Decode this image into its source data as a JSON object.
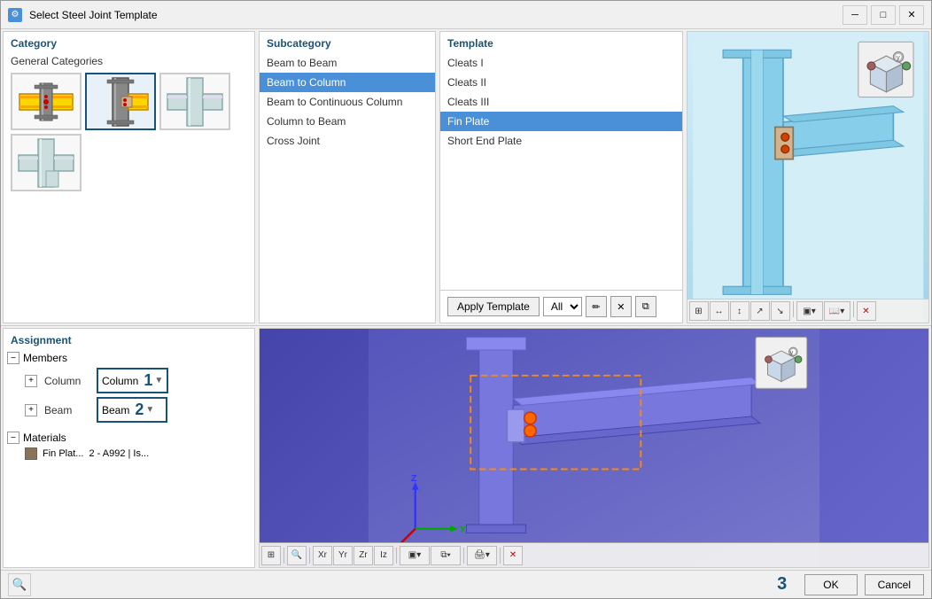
{
  "window": {
    "title": "Select Steel Joint Template",
    "icon": "⚙"
  },
  "category": {
    "header": "Category",
    "general_label": "General Categories",
    "items": [
      {
        "id": "cat-1",
        "label": "Beam-Beam Joint",
        "selected": false
      },
      {
        "id": "cat-2",
        "label": "Beam-Column Joint",
        "selected": true
      },
      {
        "id": "cat-3",
        "label": "Triple Joint",
        "selected": false
      },
      {
        "id": "cat-4",
        "label": "T-Joint",
        "selected": false
      }
    ]
  },
  "subcategory": {
    "header": "Subcategory",
    "items": [
      {
        "id": "sub-1",
        "label": "Beam to Beam",
        "selected": false
      },
      {
        "id": "sub-2",
        "label": "Beam to Column",
        "selected": true
      },
      {
        "id": "sub-3",
        "label": "Beam to Continuous Column",
        "selected": false
      },
      {
        "id": "sub-4",
        "label": "Column to Beam",
        "selected": false
      },
      {
        "id": "sub-5",
        "label": "Cross Joint",
        "selected": false
      }
    ]
  },
  "template": {
    "header": "Template",
    "items": [
      {
        "id": "tmpl-1",
        "label": "Cleats I",
        "selected": false
      },
      {
        "id": "tmpl-2",
        "label": "Cleats II",
        "selected": false
      },
      {
        "id": "tmpl-3",
        "label": "Cleats III",
        "selected": false
      },
      {
        "id": "tmpl-4",
        "label": "Fin Plate",
        "selected": true
      },
      {
        "id": "tmpl-5",
        "label": "Short End Plate",
        "selected": false
      }
    ],
    "apply_btn": "Apply Template",
    "filter_label": "All",
    "toolbar": {
      "edit": "✏",
      "close": "✕",
      "copy": "⧉"
    }
  },
  "assignment": {
    "header": "Assignment",
    "members_label": "Members",
    "materials_label": "Materials",
    "column": {
      "label": "Column",
      "value": "Column",
      "number": "1"
    },
    "beam": {
      "label": "Beam",
      "value": "Beam",
      "number": "2"
    },
    "material": {
      "label": "Fin Plat...",
      "value": "2 - A992 | Is..."
    }
  },
  "preview_toolbar": {
    "btns": [
      "⊞",
      "↔",
      "↕",
      "↗",
      "↘",
      "▣",
      "⊕",
      "✕"
    ]
  },
  "viewport_toolbar": {
    "btns": [
      "⊞",
      "🔄",
      "↔",
      "↕",
      "↗",
      "↘",
      "▣",
      "⊕",
      "🖨",
      "✕"
    ]
  },
  "footer": {
    "search_icon": "🔍",
    "step_number": "3",
    "ok_label": "OK",
    "cancel_label": "Cancel"
  }
}
